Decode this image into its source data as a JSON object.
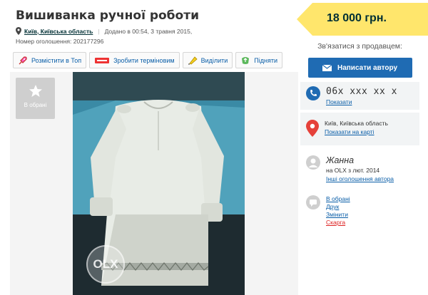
{
  "ad": {
    "title": "Вишиванка ручної роботи",
    "location": "Київ, Київська область",
    "added": "Додано в 00:54, 3 травня 2015,",
    "ad_number": "Номер оголошення: 202177296"
  },
  "actions": [
    {
      "label": "Розмістити в Топ",
      "icon": "rocket-icon"
    },
    {
      "label": "Зробити терміновим",
      "icon": "urgent-label-icon"
    },
    {
      "label": "Виділити",
      "icon": "highlighter-icon"
    },
    {
      "label": "Підняти",
      "icon": "lift-up-icon"
    }
  ],
  "gallery": {
    "favorite_label": "В обрані",
    "watermark": "OLX"
  },
  "price": "18 000 грн.",
  "sidebar": {
    "contact_title": "Зв'язатися з продавцем:",
    "message_button": "Написати автору",
    "phone": "06x xxx xx x",
    "phone_show": "Показати",
    "location": "Київ, Київська область",
    "map_link": "Показати на карті",
    "user_name": "Жанна",
    "user_since": "на OLX з лют. 2014",
    "other_ads": "Інші оголошення автора",
    "links": {
      "favorites": "В обрані",
      "print": "Друк",
      "edit": "Змінити",
      "report": "Скарга"
    }
  },
  "colors": {
    "price_bg": "#ffe66c",
    "primary": "#1f6bb3",
    "link": "#0a5ea8",
    "card_bg": "#f2f4f5",
    "pin": "#e5413a"
  }
}
